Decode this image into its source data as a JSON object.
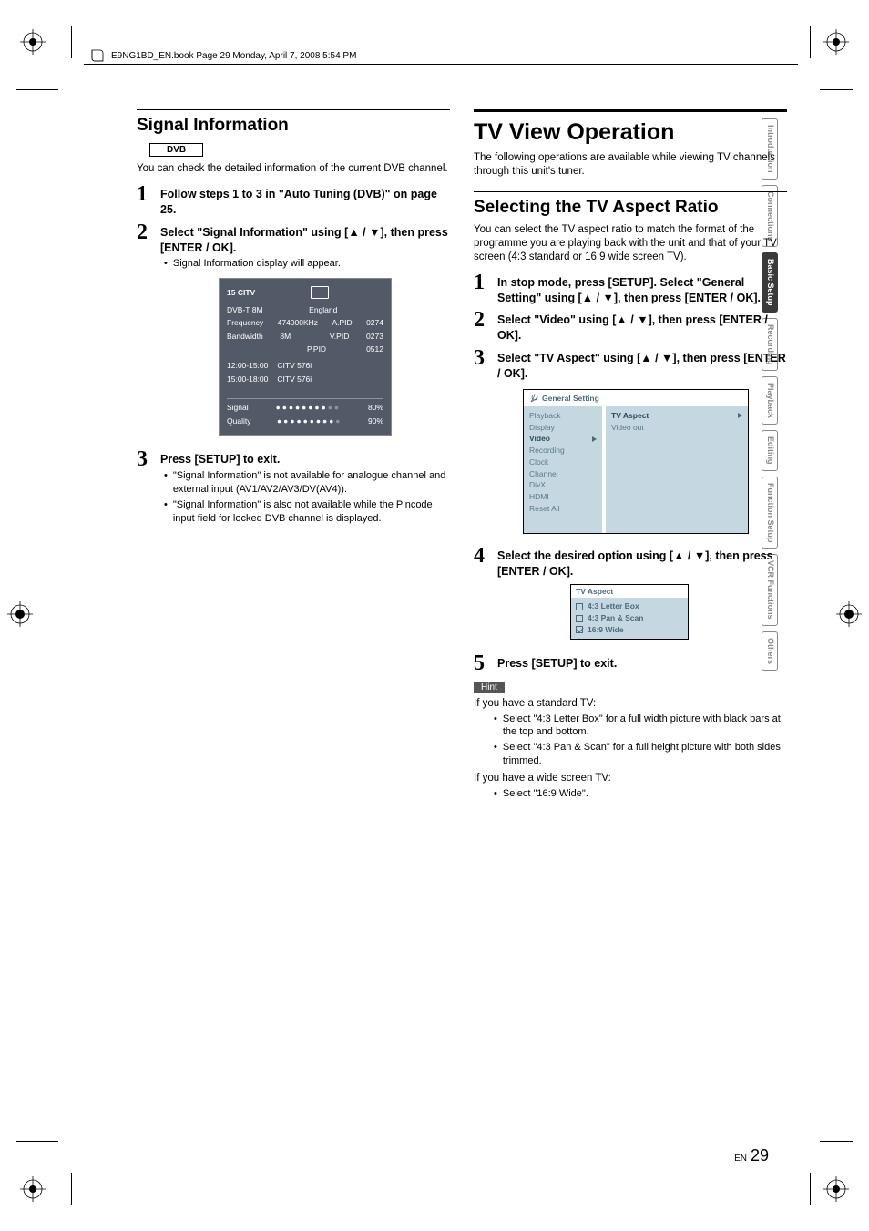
{
  "header_info": "E9NG1BD_EN.book  Page 29  Monday, April 7, 2008  5:54 PM",
  "side_tabs": [
    "Introduction",
    "Connections",
    "Basic Setup",
    "Recording",
    "Playback",
    "Editing",
    "Function Setup",
    "VCR Functions",
    "Others"
  ],
  "active_tab_index": 2,
  "left": {
    "title": "Signal Information",
    "dvb_label": "DVB",
    "intro": "You can check the detailed information of the current DVB channel.",
    "steps": [
      {
        "num": "1",
        "title": "Follow steps 1 to 3 in \"Auto Tuning (DVB)\" on page 25."
      },
      {
        "num": "2",
        "title": "Select \"Signal Information\" using [▲ / ▼], then press [ENTER / OK].",
        "bullets": [
          "Signal Information display will appear."
        ]
      },
      {
        "num": "3",
        "title": "Press [SETUP] to exit.",
        "bullets": [
          "\"Signal Information\" is not available for analogue channel and external input (AV1/AV2/AV3/DV(AV4)).",
          "\"Signal Information\" is also not available while the Pincode input field for locked DVB channel is displayed."
        ]
      }
    ],
    "signal_panel": {
      "ch": "15  CITV",
      "mode": "DVB-T 8M",
      "country": "England",
      "freq_label": "Frequency",
      "freq": "474000KHz",
      "apid_label": "A.PID",
      "apid": "0274",
      "bw_label": "Bandwidth",
      "bw": "8M",
      "vpid_label": "V.PID",
      "vpid": "0273",
      "ppid_label": "P.PID",
      "ppid": "0512",
      "t1": "12:00-15:00",
      "p1": "CITV 576i",
      "t2": "15:00-18:00",
      "p2": "CITV 576i",
      "signal_label": "Signal",
      "signal_pct": "80%",
      "quality_label": "Quality",
      "quality_pct": "90%"
    }
  },
  "right": {
    "main_title": "TV View Operation",
    "main_intro": "The following operations are available while viewing TV channels through this unit's tuner.",
    "sub_title": "Selecting the TV Aspect Ratio",
    "sub_intro": "You can select the TV aspect ratio to match the format of the programme you are playing back with the unit and that of your TV screen (4:3 standard or 16:9 wide screen TV).",
    "steps": [
      {
        "num": "1",
        "title": "In stop mode, press [SETUP]. Select \"General Setting\" using [▲ / ▼], then press [ENTER / OK]."
      },
      {
        "num": "2",
        "title": "Select \"Video\" using [▲ / ▼], then press [ENTER / OK]."
      },
      {
        "num": "3",
        "title": "Select \"TV Aspect\" using [▲ / ▼], then press [ENTER / OK]."
      },
      {
        "num": "4",
        "title": "Select the desired option using [▲ / ▼], then press [ENTER / OK]."
      },
      {
        "num": "5",
        "title": "Press [SETUP] to exit."
      }
    ],
    "settings_panel": {
      "title": "General Setting",
      "left_items": [
        "Playback",
        "Display",
        "Video",
        "Recording",
        "Clock",
        "Channel",
        "DivX",
        "HDMI",
        "Reset All"
      ],
      "left_selected_index": 2,
      "right_items": [
        "TV Aspect",
        "Video out"
      ],
      "right_selected_index": 0
    },
    "aspect_panel": {
      "title": "TV Aspect",
      "options": [
        "4:3 Letter Box",
        "4:3 Pan & Scan",
        "16:9 Wide"
      ],
      "selected_index": 2
    },
    "hint_label": "Hint",
    "hint_std": "If you have a standard TV:",
    "hint_std_items": [
      "Select \"4:3 Letter Box\" for a full width picture with black bars at the top and bottom.",
      "Select \"4:3 Pan & Scan\" for a full height picture with both sides trimmed."
    ],
    "hint_wide": "If you have a wide screen TV:",
    "hint_wide_items": [
      "Select \"16:9 Wide\"."
    ]
  },
  "page_en": "EN",
  "page_num": "29"
}
